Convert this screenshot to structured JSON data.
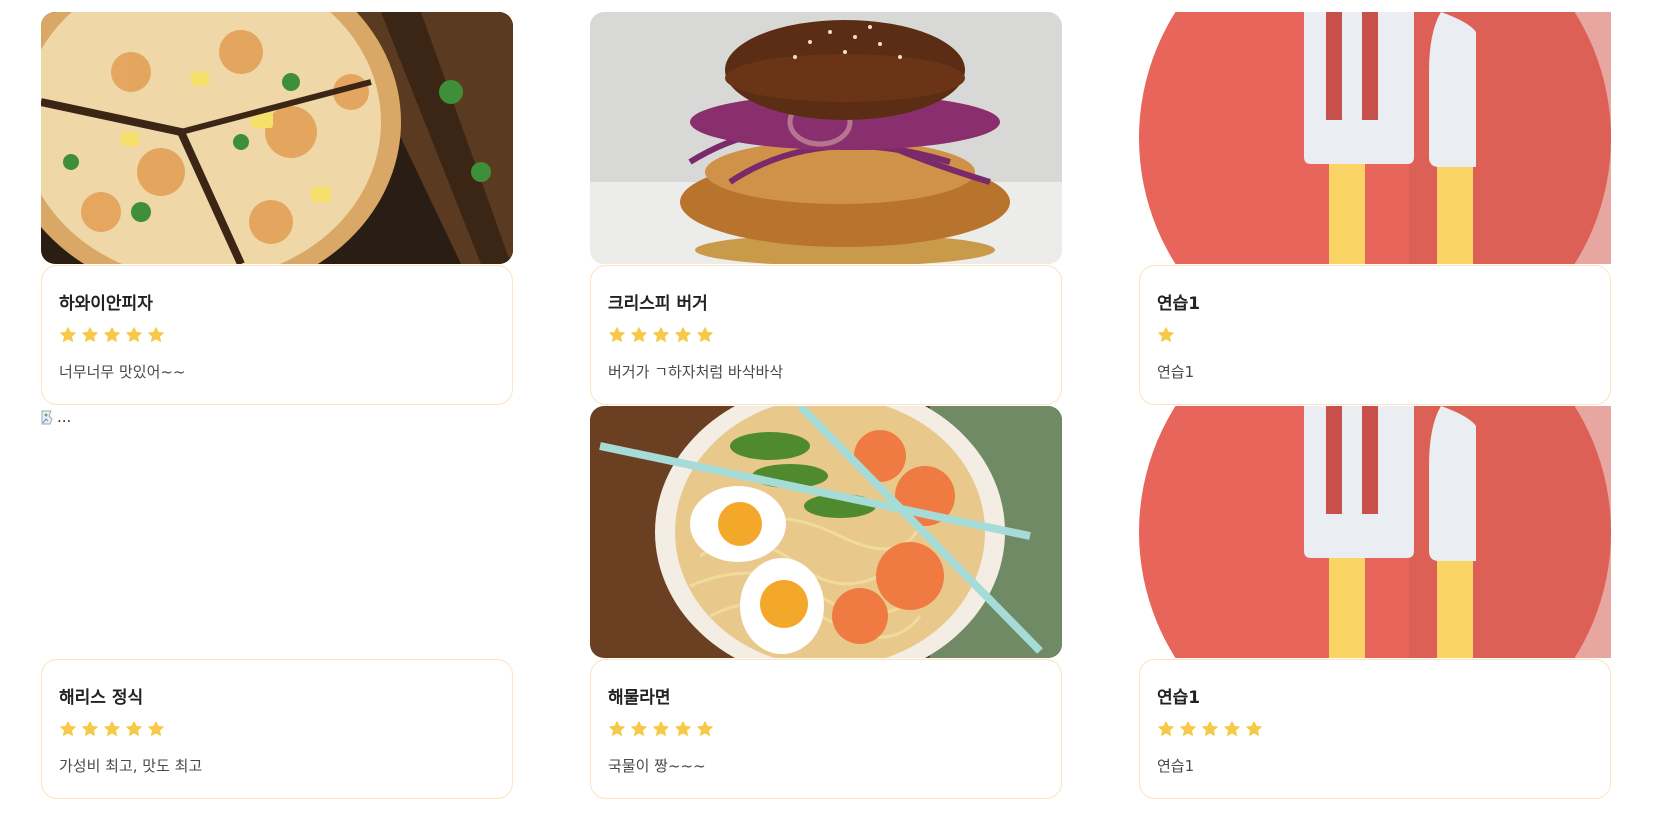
{
  "colors": {
    "card_border": "#fde3bf",
    "star": "#f7c948",
    "placeholder_bg": "#e7655a",
    "utensil": "#eaeef2",
    "utensil_handle": "#fad566"
  },
  "cards": [
    {
      "title": "하와이안피자",
      "rating": 5,
      "desc": "너무너무 맛있어~~",
      "image_icon": "pizza-photo"
    },
    {
      "title": "크리스피 버거",
      "rating": 5,
      "desc": "버거가 ㄱ하자처럼 바삭바삭",
      "image_icon": "burger-photo"
    },
    {
      "title": "연습1",
      "rating": 1,
      "desc": "연습1",
      "image_icon": "fork-knife-placeholder-icon"
    },
    {
      "title": "해리스 정식",
      "rating": 5,
      "desc": "가성비 최고, 맛도 최고",
      "image_icon": "broken-image-icon",
      "image_alt": "..."
    },
    {
      "title": "해물라면",
      "rating": 5,
      "desc": "국물이 짱~~~",
      "image_icon": "ramen-photo"
    },
    {
      "title": "연습1",
      "rating": 5,
      "desc": "연습1",
      "image_icon": "fork-knife-placeholder-icon"
    }
  ]
}
